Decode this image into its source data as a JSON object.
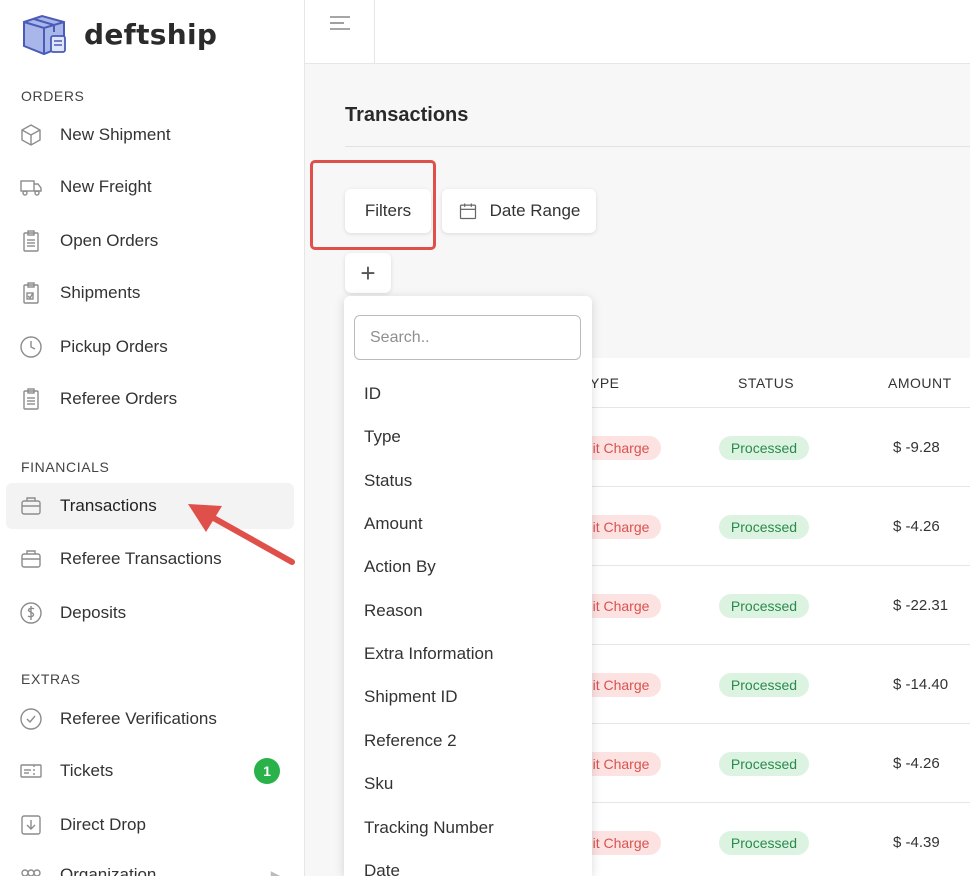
{
  "brand": {
    "name": "deftship"
  },
  "sidebar": {
    "sections": [
      {
        "label": "ORDERS"
      },
      {
        "label": "FINANCIALS"
      },
      {
        "label": "EXTRAS"
      }
    ],
    "items": [
      {
        "label": "New Shipment",
        "icon": "box-icon"
      },
      {
        "label": "New Freight",
        "icon": "truck-icon"
      },
      {
        "label": "Open Orders",
        "icon": "clipboard-icon"
      },
      {
        "label": "Shipments",
        "icon": "clipboard-check-icon"
      },
      {
        "label": "Pickup Orders",
        "icon": "clock-icon"
      },
      {
        "label": "Referee Orders",
        "icon": "clipboard-icon"
      },
      {
        "label": "Transactions",
        "icon": "wallet-icon",
        "active": true
      },
      {
        "label": "Referee Transactions",
        "icon": "wallet-icon"
      },
      {
        "label": "Deposits",
        "icon": "dollar-circle-icon"
      },
      {
        "label": "Referee Verifications",
        "icon": "check-circle-icon"
      },
      {
        "label": "Tickets",
        "icon": "ticket-icon",
        "badge": "1"
      },
      {
        "label": "Direct Drop",
        "icon": "download-box-icon"
      },
      {
        "label": "Organization",
        "icon": "org-icon"
      }
    ]
  },
  "main": {
    "title": "Transactions",
    "filters_label": "Filters",
    "date_range_label": "Date Range",
    "add_label": "+"
  },
  "table": {
    "columns": [
      "YPE",
      "STATUS",
      "AMOUNT"
    ],
    "rows": [
      {
        "type": "it Charge",
        "status": "Processed",
        "amount": "$ -9.28"
      },
      {
        "type": "it Charge",
        "status": "Processed",
        "amount": "$ -4.26"
      },
      {
        "type": "it Charge",
        "status": "Processed",
        "amount": "$ -22.31"
      },
      {
        "type": "it Charge",
        "status": "Processed",
        "amount": "$ -14.40"
      },
      {
        "type": "it Charge",
        "status": "Processed",
        "amount": "$ -4.26"
      },
      {
        "type": "it Charge",
        "status": "Processed",
        "amount": "$ -4.39"
      }
    ]
  },
  "dropdown": {
    "search_placeholder": "Search..",
    "options": [
      "ID",
      "Type",
      "Status",
      "Amount",
      "Action By",
      "Reason",
      "Extra Information",
      "Shipment ID",
      "Reference 2",
      "Sku",
      "Tracking Number",
      "Date"
    ]
  },
  "colors": {
    "highlight": "#e0504b",
    "badge": "#2ab24a",
    "status_bg": "#dcf3e2",
    "type_bg": "#fde2e2"
  }
}
